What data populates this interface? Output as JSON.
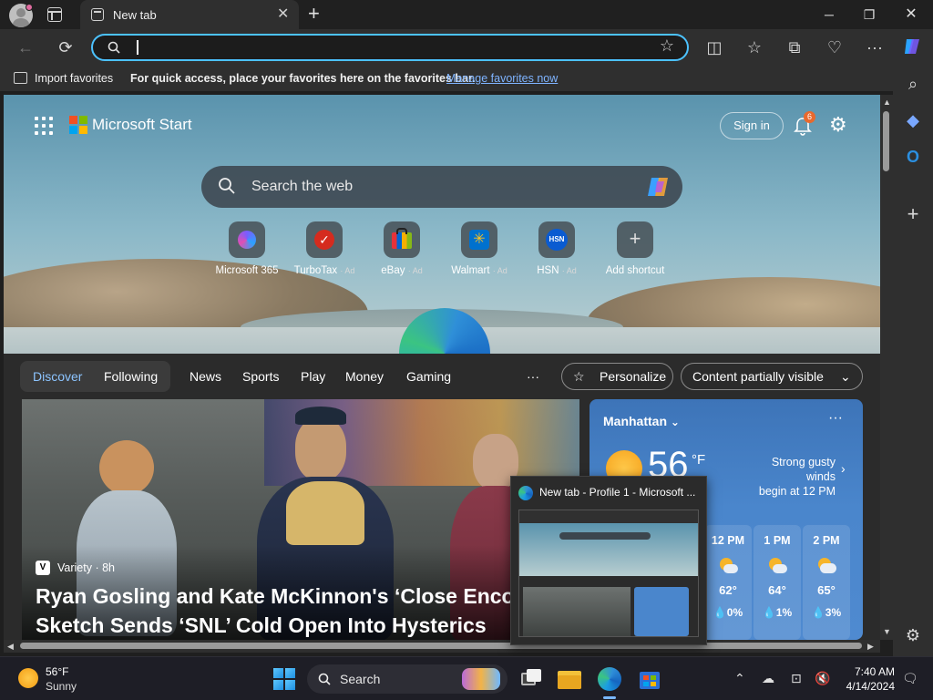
{
  "browser": {
    "tab_title": "New tab",
    "address_value": "",
    "favorites_bar": {
      "import_label": "Import favorites",
      "hint": "For quick access, place your favorites here on the favorites bar.",
      "manage_link": "Manage favorites now"
    }
  },
  "start": {
    "brand": "Microsoft Start",
    "signin_label": "Sign in",
    "notification_count": "6",
    "search_placeholder": "Search the web",
    "shortcuts": [
      {
        "label": "Microsoft 365",
        "ad": ""
      },
      {
        "label": "TurboTax",
        "ad": "· Ad"
      },
      {
        "label": "eBay",
        "ad": "· Ad"
      },
      {
        "label": "Walmart",
        "ad": "· Ad"
      },
      {
        "label": "HSN",
        "ad": "· Ad"
      },
      {
        "label": "Add shortcut",
        "ad": ""
      }
    ],
    "feed_tabs": [
      "Discover",
      "Following",
      "News",
      "Sports",
      "Play",
      "Money",
      "Gaming"
    ],
    "more_label": "···",
    "personalize_label": "Personalize",
    "content_visibility_label": "Content partially visible"
  },
  "hero": {
    "source": "Variety · 8h",
    "source_icon": "V",
    "title_line1": "Ryan Gosling and Kate McKinnon's ‘Close Encou",
    "title_line2": "Sketch Sends ‘SNL’ Cold Open Into Hysterics"
  },
  "weather": {
    "location": "Manhattan",
    "temp": "56",
    "unit": "°F",
    "alert_line1": "Strong gusty winds",
    "alert_line2": "begin at 12 PM",
    "hours": [
      {
        "time": "12 PM",
        "temp": "62°",
        "precip": "💧0%"
      },
      {
        "time": "1 PM",
        "temp": "64°",
        "precip": "💧1%"
      },
      {
        "time": "2 PM",
        "temp": "65°",
        "precip": "💧3%"
      }
    ]
  },
  "preview": {
    "title": "New tab - Profile 1 - Microsoft ..."
  },
  "taskbar": {
    "weather_temp": "56°F",
    "weather_cond": "Sunny",
    "search_label": "Search",
    "time": "7:40 AM",
    "date": "4/14/2024"
  }
}
